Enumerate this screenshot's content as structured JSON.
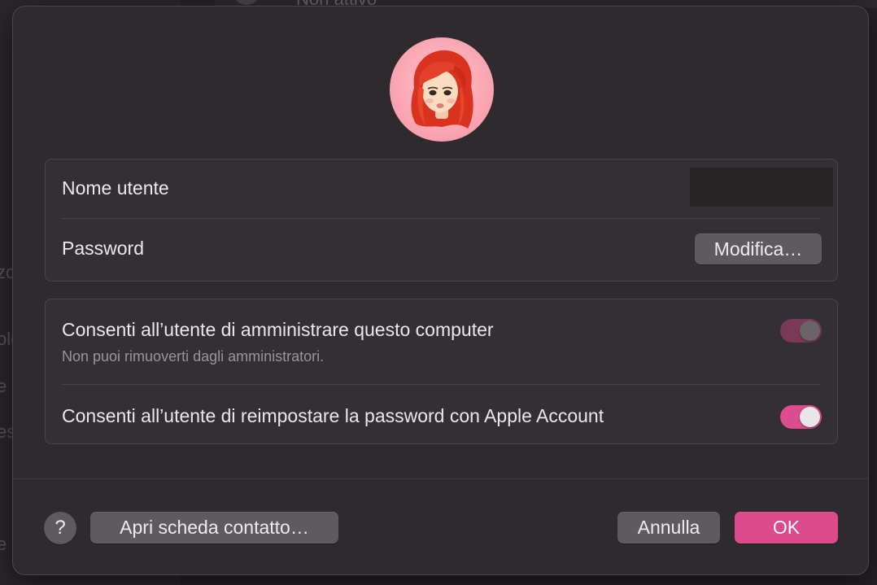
{
  "background": {
    "top_text": "Non attivo",
    "side_fragments": [
      "zo",
      "olo",
      "e",
      "es",
      "e"
    ]
  },
  "avatar": {
    "icon": "memoji-avatar"
  },
  "account": {
    "username_label": "Nome utente",
    "username_value": "",
    "password_label": "Password",
    "change_password_button": "Modifica…"
  },
  "permissions": {
    "admin_label": "Consenti all’utente di amministrare questo computer",
    "admin_note": "Non puoi rimuoverti dagli amministratori.",
    "admin_enabled": true,
    "admin_locked": true,
    "reset_label": "Consenti all’utente di reimpostare la password con Apple Account",
    "reset_enabled": true
  },
  "footer": {
    "help_label": "?",
    "contact_button": "Apri scheda contatto…",
    "cancel_button": "Annulla",
    "ok_button": "OK"
  },
  "colors": {
    "accent": "#db4a8b",
    "sheet_bg": "#2f2a2e"
  }
}
